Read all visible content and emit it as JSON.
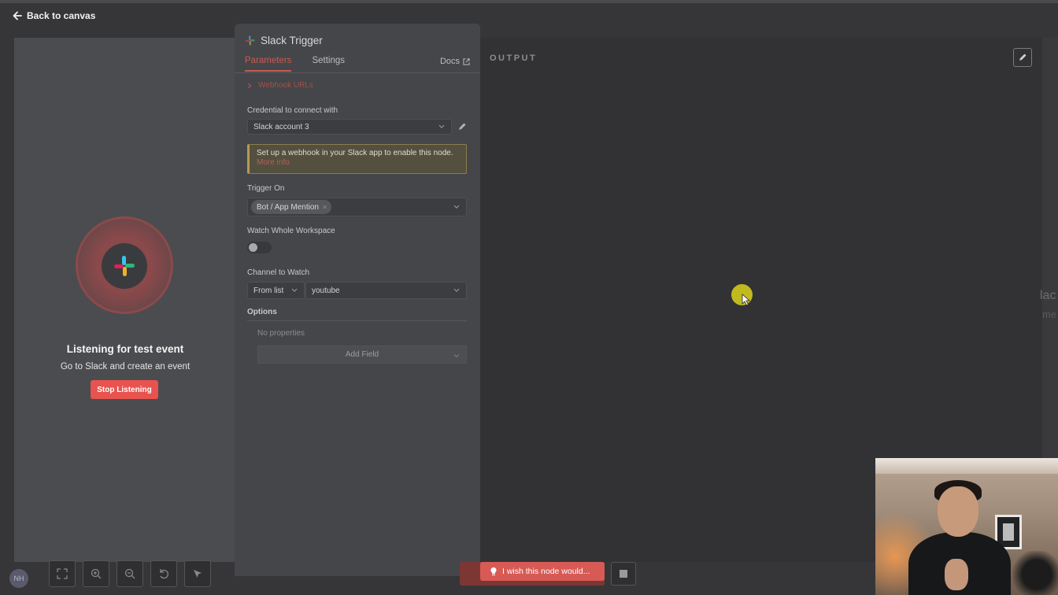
{
  "nav": {
    "back_label": "Back to canvas"
  },
  "left_pane": {
    "title": "Listening for test event",
    "subtitle": "Go to Slack and create an event",
    "stop_button": "Stop Listening"
  },
  "panel": {
    "title": "Slack Trigger",
    "tabs": [
      {
        "label": "Parameters",
        "active": true
      },
      {
        "label": "Settings",
        "active": false
      }
    ],
    "docs_label": "Docs",
    "webhook_label": "Webhook URLs",
    "credential": {
      "label": "Credential to connect with",
      "value": "Slack account 3"
    },
    "notice": {
      "text": "Set up a webhook in your Slack app to enable this node.",
      "link": "More info"
    },
    "trigger_on": {
      "label": "Trigger On",
      "chip": "Bot / App Mention"
    },
    "watch_workspace": {
      "label": "Watch Whole Workspace",
      "enabled": false
    },
    "channel": {
      "label": "Channel to Watch",
      "mode": "From list",
      "value": "youtube"
    },
    "options": {
      "label": "Options",
      "empty_text": "No properties",
      "add_field": "Add Field"
    }
  },
  "output": {
    "label": "OUTPUT"
  },
  "bottom": {
    "avatar_initials": "NH",
    "wish_label": "I wish this node would..."
  },
  "edge": {
    "text1": "lac",
    "text2": "me"
  },
  "colors": {
    "accent": "#e8534f",
    "tab_active": "#c75b55",
    "cursor_highlight": "#c8c21f",
    "warning_border": "#b59a53"
  }
}
